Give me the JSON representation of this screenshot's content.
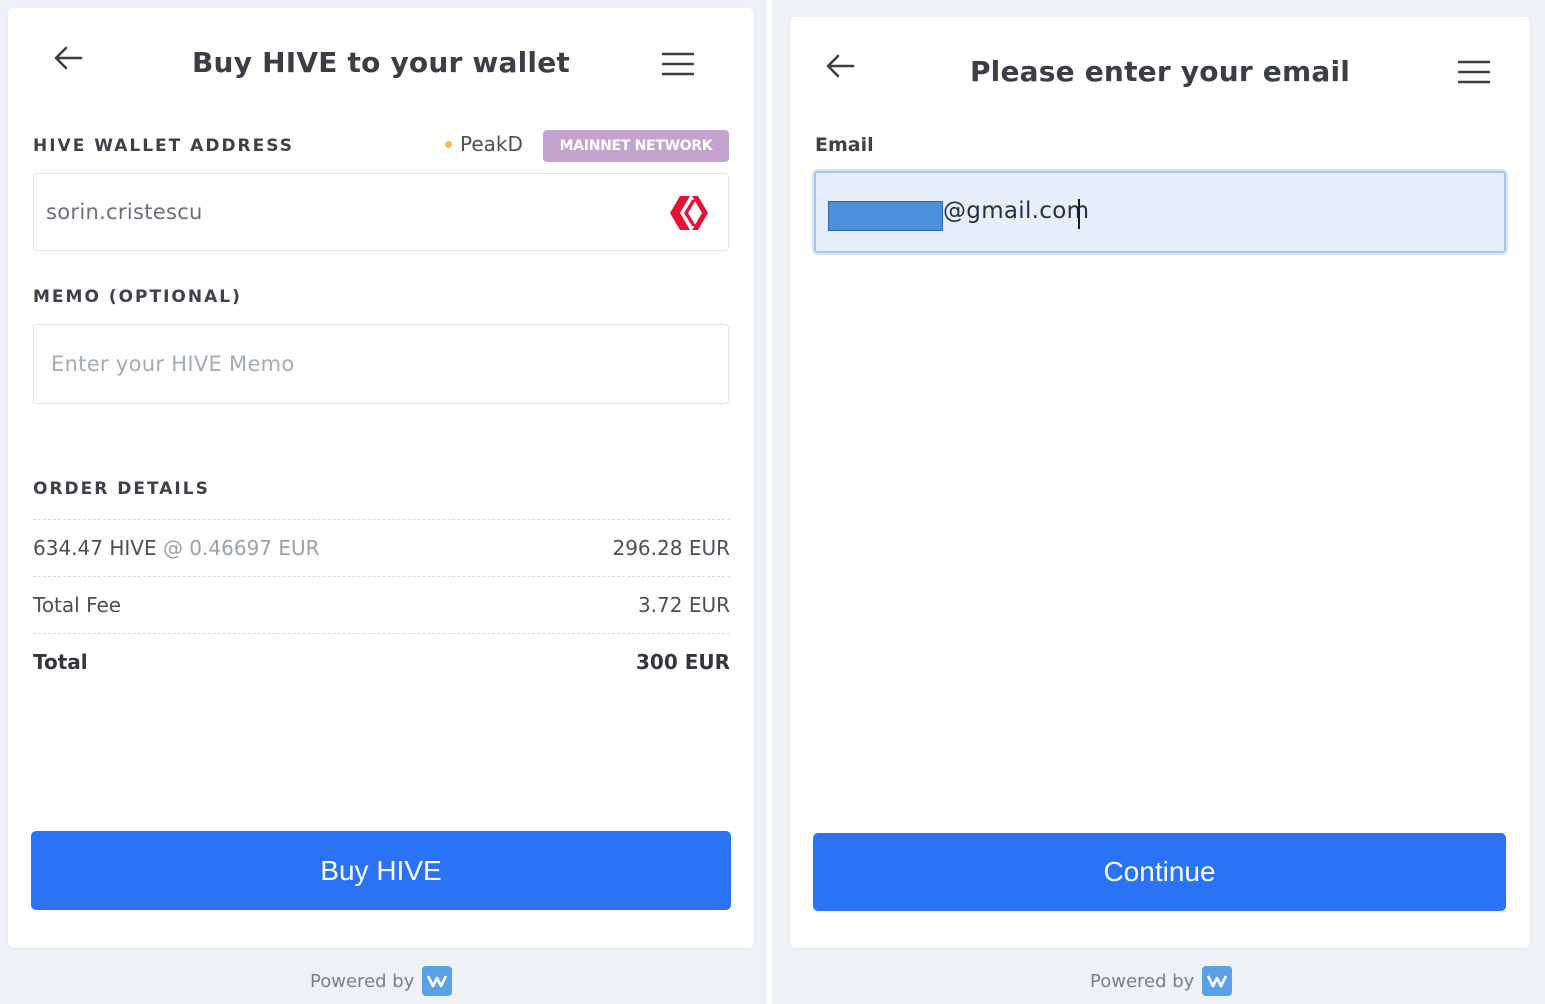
{
  "left": {
    "title": "Buy HIVE to your wallet",
    "wallet_label": "HIVE WALLET ADDRESS",
    "provider": "PeakD",
    "network_badge": "MAINNET NETWORK",
    "wallet_value": "sorin.cristescu",
    "memo_label": "MEMO (OPTIONAL)",
    "memo_placeholder": "Enter your HIVE Memo",
    "order_label": "ORDER DETAILS",
    "order_rows": [
      {
        "label": "634.47 HIVE",
        "rate": "@ 0.46697 EUR",
        "amount": "296.28 EUR"
      },
      {
        "label": "Total Fee",
        "rate": "",
        "amount": "3.72 EUR"
      },
      {
        "label": "Total",
        "rate": "",
        "amount": "300 EUR"
      }
    ],
    "button_label": "Buy HIVE",
    "powered_by": "Powered by"
  },
  "right": {
    "title": "Please enter your email",
    "email_label": "Email",
    "email_domain": "@gmail.com",
    "button_label": "Continue",
    "powered_by": "Powered by"
  },
  "colors": {
    "primary": "#2a73f5",
    "badge": "#c5a3cf",
    "hive_red": "#e31337",
    "provider_dot": "#f2c14e"
  },
  "icons": {
    "back": "arrow-left-icon",
    "menu": "hamburger-menu-icon",
    "hive": "hive-logo-icon",
    "powered": "transak-logo-icon"
  }
}
